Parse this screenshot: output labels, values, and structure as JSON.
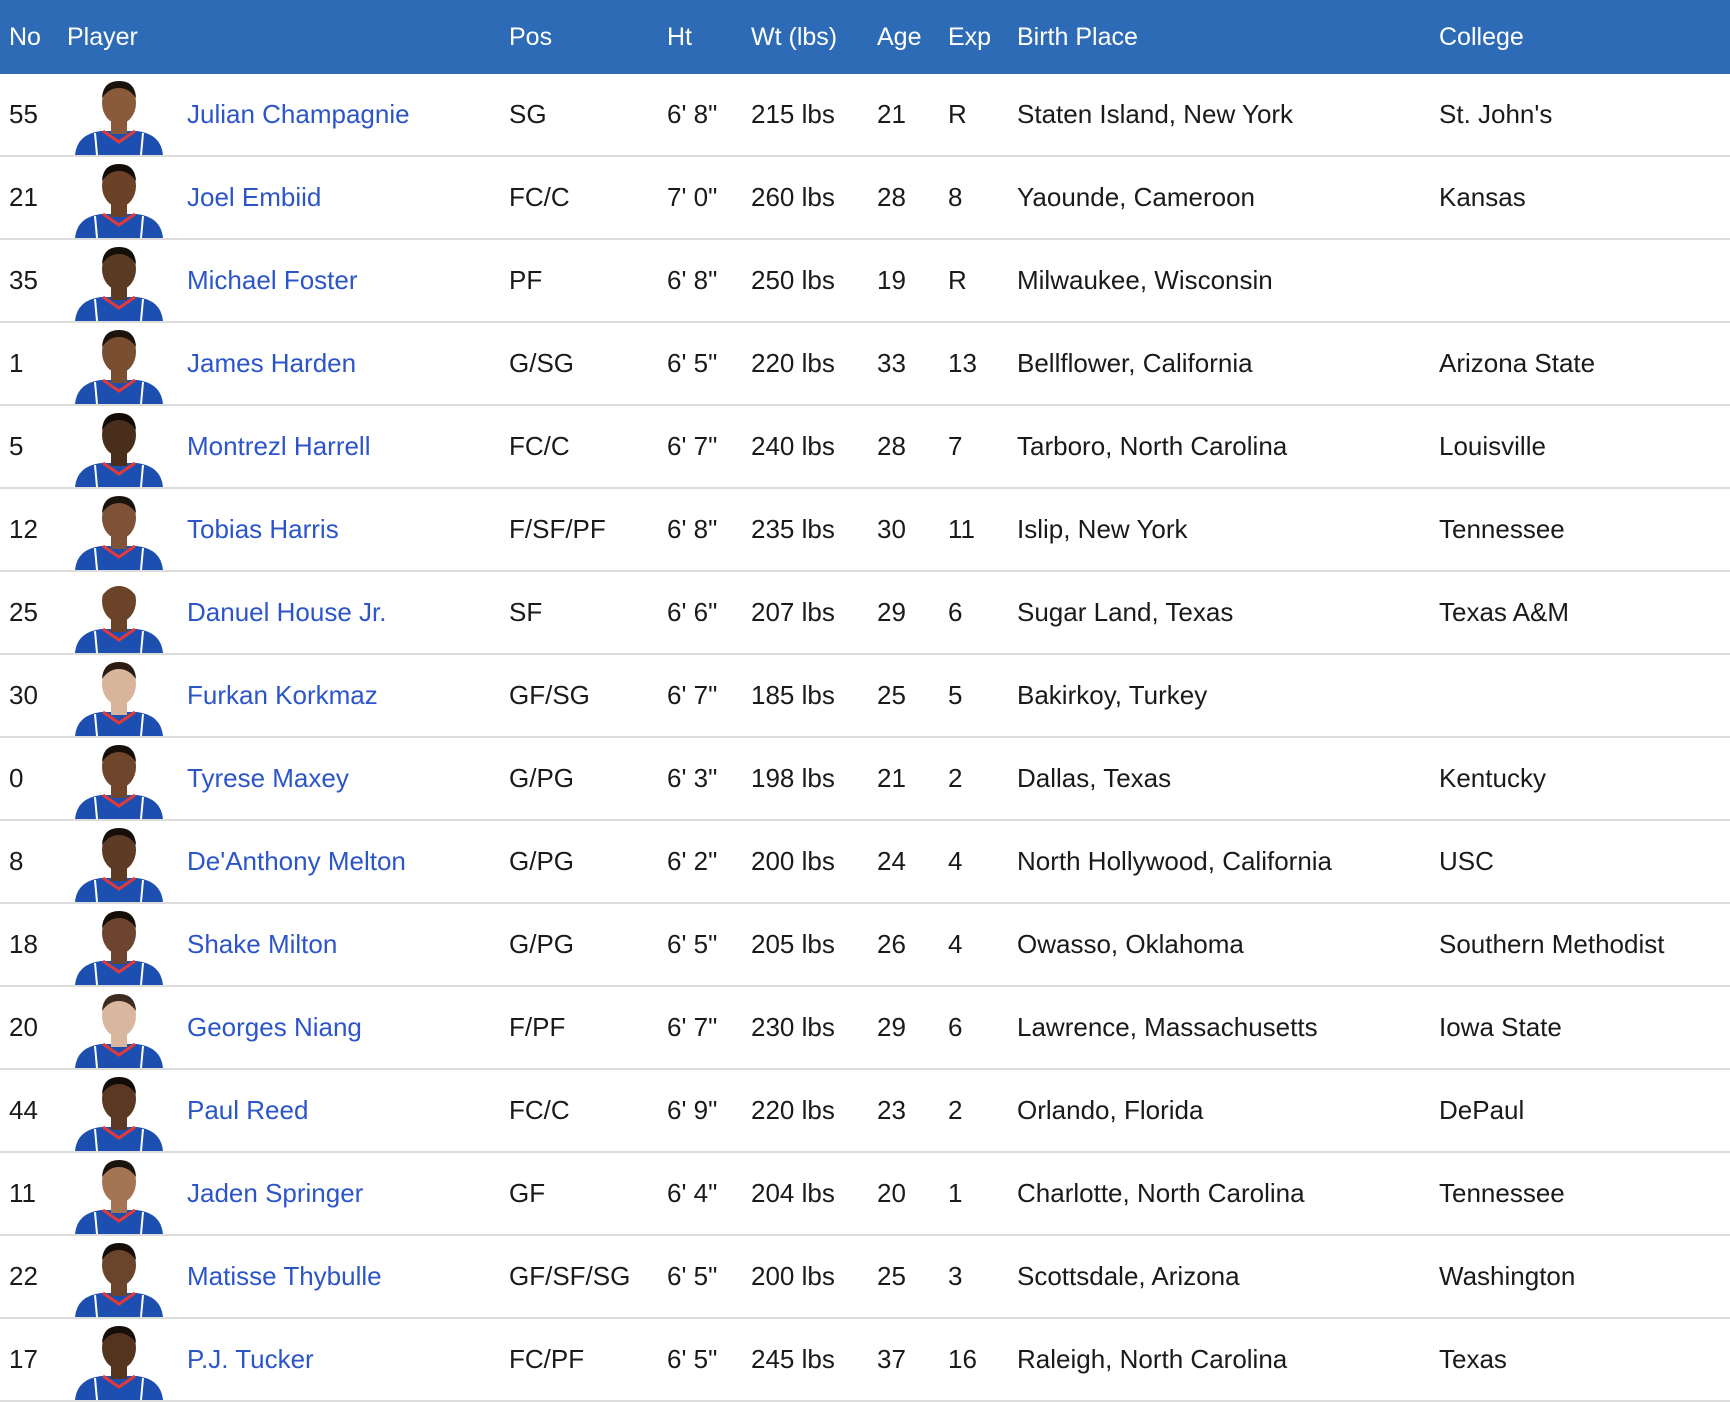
{
  "columns": {
    "no": "No",
    "player": "Player",
    "pos": "Pos",
    "ht": "Ht",
    "wt": "Wt (lbs)",
    "age": "Age",
    "exp": "Exp",
    "birth_place": "Birth Place",
    "college": "College"
  },
  "colors": {
    "header_bg": "#2e6bb6",
    "link": "#2b55c9",
    "jersey": "#1d4fb0",
    "jersey_trim": "#e23a3a"
  },
  "players": [
    {
      "no": "55",
      "name": "Julian Champagnie",
      "pos": "SG",
      "ht": "6' 8\"",
      "wt": "215 lbs",
      "age": "21",
      "exp": "R",
      "birth_place": "Staten Island, New York",
      "college": "St. John's",
      "photo": "player-headshot-icon"
    },
    {
      "no": "21",
      "name": "Joel Embiid",
      "pos": "FC/C",
      "ht": "7' 0\"",
      "wt": "260 lbs",
      "age": "28",
      "exp": "8",
      "birth_place": "Yaounde, Cameroon",
      "college": "Kansas",
      "photo": "player-headshot-icon"
    },
    {
      "no": "35",
      "name": "Michael Foster",
      "pos": "PF",
      "ht": "6' 8\"",
      "wt": "250 lbs",
      "age": "19",
      "exp": "R",
      "birth_place": "Milwaukee, Wisconsin",
      "college": "",
      "photo": "player-headshot-icon"
    },
    {
      "no": "1",
      "name": "James Harden",
      "pos": "G/SG",
      "ht": "6' 5\"",
      "wt": "220 lbs",
      "age": "33",
      "exp": "13",
      "birth_place": "Bellflower, California",
      "college": "Arizona State",
      "photo": "player-headshot-icon"
    },
    {
      "no": "5",
      "name": "Montrezl Harrell",
      "pos": "FC/C",
      "ht": "6' 7\"",
      "wt": "240 lbs",
      "age": "28",
      "exp": "7",
      "birth_place": "Tarboro, North Carolina",
      "college": "Louisville",
      "photo": "player-headshot-icon"
    },
    {
      "no": "12",
      "name": "Tobias Harris",
      "pos": "F/SF/PF",
      "ht": "6' 8\"",
      "wt": "235 lbs",
      "age": "30",
      "exp": "11",
      "birth_place": "Islip, New York",
      "college": "Tennessee",
      "photo": "player-headshot-icon"
    },
    {
      "no": "25",
      "name": "Danuel House Jr.",
      "pos": "SF",
      "ht": "6' 6\"",
      "wt": "207 lbs",
      "age": "29",
      "exp": "6",
      "birth_place": "Sugar Land, Texas",
      "college": "Texas A&M",
      "photo": "player-headshot-icon"
    },
    {
      "no": "30",
      "name": "Furkan Korkmaz",
      "pos": "GF/SG",
      "ht": "6' 7\"",
      "wt": "185 lbs",
      "age": "25",
      "exp": "5",
      "birth_place": "Bakirkoy, Turkey",
      "college": "",
      "photo": "player-headshot-icon"
    },
    {
      "no": "0",
      "name": "Tyrese Maxey",
      "pos": "G/PG",
      "ht": "6' 3\"",
      "wt": "198 lbs",
      "age": "21",
      "exp": "2",
      "birth_place": "Dallas, Texas",
      "college": "Kentucky",
      "photo": "player-headshot-icon"
    },
    {
      "no": "8",
      "name": "De'Anthony Melton",
      "pos": "G/PG",
      "ht": "6' 2\"",
      "wt": "200 lbs",
      "age": "24",
      "exp": "4",
      "birth_place": "North Hollywood, California",
      "college": "USC",
      "photo": "player-headshot-icon"
    },
    {
      "no": "18",
      "name": "Shake Milton",
      "pos": "G/PG",
      "ht": "6' 5\"",
      "wt": "205 lbs",
      "age": "26",
      "exp": "4",
      "birth_place": "Owasso, Oklahoma",
      "college": "Southern Methodist",
      "photo": "player-headshot-icon"
    },
    {
      "no": "20",
      "name": "Georges Niang",
      "pos": "F/PF",
      "ht": "6' 7\"",
      "wt": "230 lbs",
      "age": "29",
      "exp": "6",
      "birth_place": "Lawrence, Massachusetts",
      "college": "Iowa State",
      "photo": "player-headshot-icon"
    },
    {
      "no": "44",
      "name": "Paul Reed",
      "pos": "FC/C",
      "ht": "6' 9\"",
      "wt": "220 lbs",
      "age": "23",
      "exp": "2",
      "birth_place": "Orlando, Florida",
      "college": "DePaul",
      "photo": "player-headshot-icon"
    },
    {
      "no": "11",
      "name": "Jaden Springer",
      "pos": "GF",
      "ht": "6' 4\"",
      "wt": "204 lbs",
      "age": "20",
      "exp": "1",
      "birth_place": "Charlotte, North Carolina",
      "college": "Tennessee",
      "photo": "player-headshot-icon"
    },
    {
      "no": "22",
      "name": "Matisse Thybulle",
      "pos": "GF/SF/SG",
      "ht": "6' 5\"",
      "wt": "200 lbs",
      "age": "25",
      "exp": "3",
      "birth_place": "Scottsdale, Arizona",
      "college": "Washington",
      "photo": "player-headshot-icon"
    },
    {
      "no": "17",
      "name": "P.J. Tucker",
      "pos": "FC/PF",
      "ht": "6' 5\"",
      "wt": "245 lbs",
      "age": "37",
      "exp": "16",
      "birth_place": "Raleigh, North Carolina",
      "college": "Texas",
      "photo": "player-headshot-icon"
    }
  ]
}
